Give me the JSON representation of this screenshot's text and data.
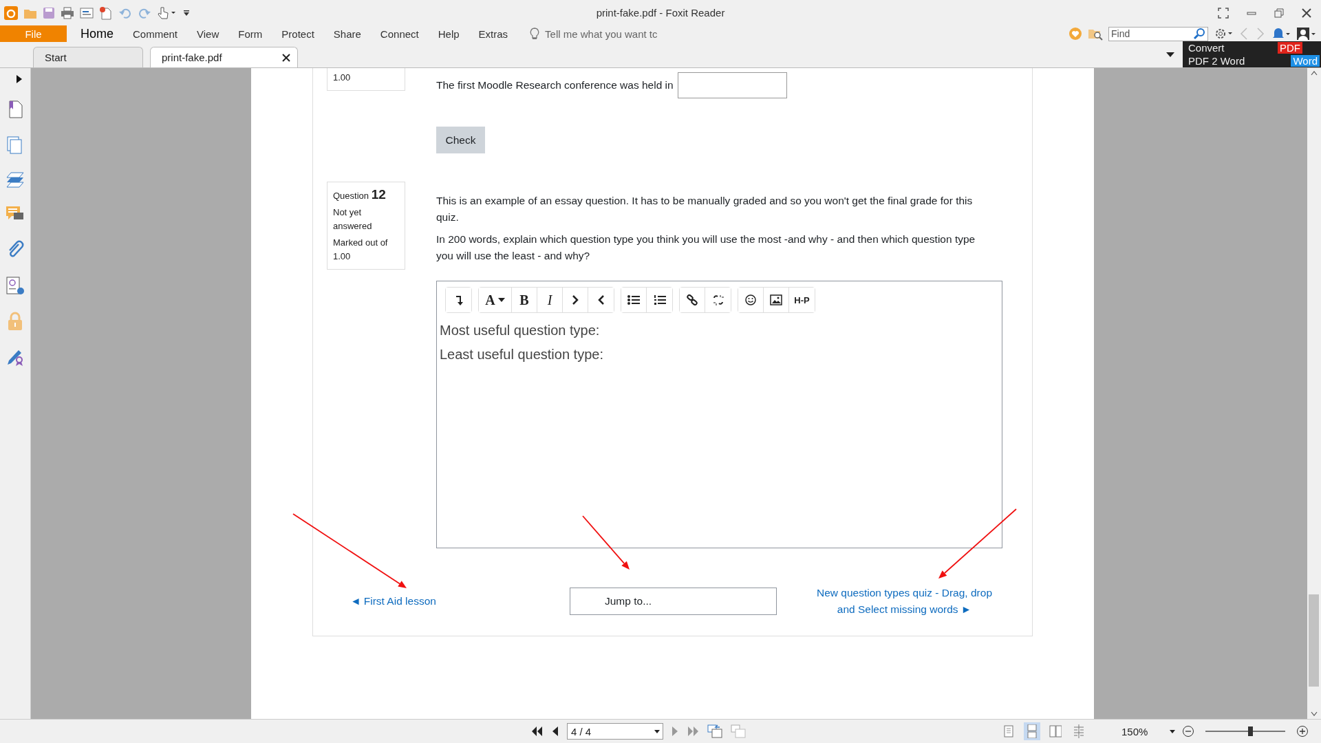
{
  "window": {
    "title": "print-fake.pdf - Foxit Reader"
  },
  "ribbon_tabs": [
    {
      "label": "File",
      "kind": "file",
      "selected": false
    },
    {
      "label": "Home",
      "kind": "tab",
      "selected": true
    },
    {
      "label": "Comment",
      "kind": "tab",
      "selected": false
    },
    {
      "label": "View",
      "kind": "tab",
      "selected": false
    },
    {
      "label": "Form",
      "kind": "tab",
      "selected": false
    },
    {
      "label": "Protect",
      "kind": "tab",
      "selected": false
    },
    {
      "label": "Share",
      "kind": "tab",
      "selected": false
    },
    {
      "label": "Connect",
      "kind": "tab",
      "selected": false
    },
    {
      "label": "Help",
      "kind": "tab",
      "selected": false
    },
    {
      "label": "Extras",
      "kind": "tab",
      "selected": false
    }
  ],
  "tell_me": {
    "placeholder": "Tell me what you want tc"
  },
  "find": {
    "placeholder": "Find"
  },
  "doc_tabs": [
    {
      "label": "Start",
      "selected": false
    },
    {
      "label": "print-fake.pdf",
      "selected": true
    }
  ],
  "convert_ad": {
    "line1": "Convert",
    "line2": "PDF 2 Word",
    "badge_top": "PDF",
    "badge_bottom": "Word"
  },
  "document": {
    "previous_question": {
      "grade": "1.00"
    },
    "fill_question": {
      "text": "The first Moodle Research conference was held in",
      "check_button": "Check"
    },
    "question": {
      "label": "Question",
      "number": "12",
      "state": "Not yet answered",
      "marks": "Marked out of 1.00",
      "paragraphs": [
        "This is an example of an essay question. It has to be manually graded and so you won't get the final grade for this quiz.",
        "In 200 words, explain which question type you think you will use the most  -and why - and then which question type you will use the least - and why?"
      ],
      "editor": {
        "toolbar": [
          [
            {
              "kind": "collapse"
            }
          ],
          [
            {
              "kind": "font",
              "label": "A"
            },
            {
              "kind": "bold",
              "label": "B"
            },
            {
              "kind": "italic",
              "label": "I"
            },
            {
              "kind": "indent"
            },
            {
              "kind": "outdent"
            }
          ],
          [
            {
              "kind": "bullets"
            },
            {
              "kind": "numbers"
            }
          ],
          [
            {
              "kind": "link"
            },
            {
              "kind": "unlink"
            }
          ],
          [
            {
              "kind": "emoji"
            },
            {
              "kind": "image"
            },
            {
              "kind": "h5p",
              "label": "H-P"
            }
          ]
        ],
        "lines": [
          "Most useful question type:",
          "Least useful question type:"
        ]
      }
    },
    "navigation": {
      "previous_link": "◄ First Aid lesson",
      "jump": "Jump to...",
      "next_link": "New question types quiz - Drag, drop and Select missing words ►"
    }
  },
  "status_bar": {
    "page": "4 / 4",
    "view_modes": [
      {
        "kind": "single",
        "selected": false
      },
      {
        "kind": "continuous",
        "selected": true
      },
      {
        "kind": "facing",
        "selected": false
      },
      {
        "kind": "split",
        "selected": false
      }
    ],
    "zoom": "150%",
    "zoom_slider": {
      "level": 0.56
    }
  }
}
